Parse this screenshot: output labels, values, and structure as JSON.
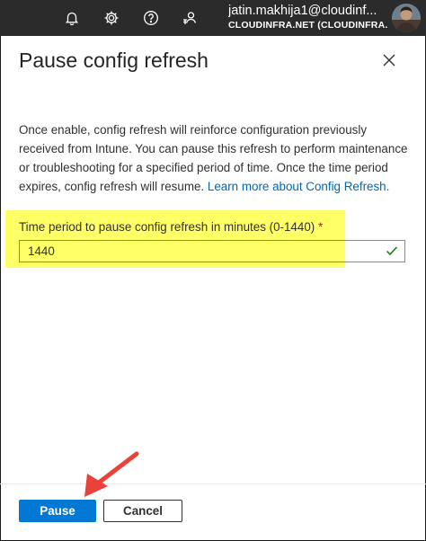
{
  "topbar": {
    "icons": [
      "bell-icon",
      "gear-icon",
      "help-icon",
      "feedback-icon"
    ],
    "account_user": "jatin.makhija1@cloudinf...",
    "account_tenant": "CLOUDINFRA.NET (CLOUDINFRA...",
    "bg_color": "#2b2b2b"
  },
  "panel": {
    "title": "Pause config refresh",
    "description": "Once enable, config refresh will reinforce configuration previously received from Intune. You can pause this refresh to perform maintenance or troubleshooting for a specified period of time. Once the time period expires, config refresh will resume. ",
    "learn_more_link": "Learn more about Config Refresh.",
    "field": {
      "label": "Time period to pause config refresh in minutes (0-1440)",
      "required_marker": "*",
      "value": "1440",
      "valid": true
    },
    "buttons": {
      "primary": "Pause",
      "secondary": "Cancel"
    }
  },
  "colors": {
    "accent": "#0078d4",
    "link": "#0067b8",
    "highlight": "#ffff66",
    "annotation_arrow": "#e8423b",
    "valid_check": "#107c10"
  }
}
